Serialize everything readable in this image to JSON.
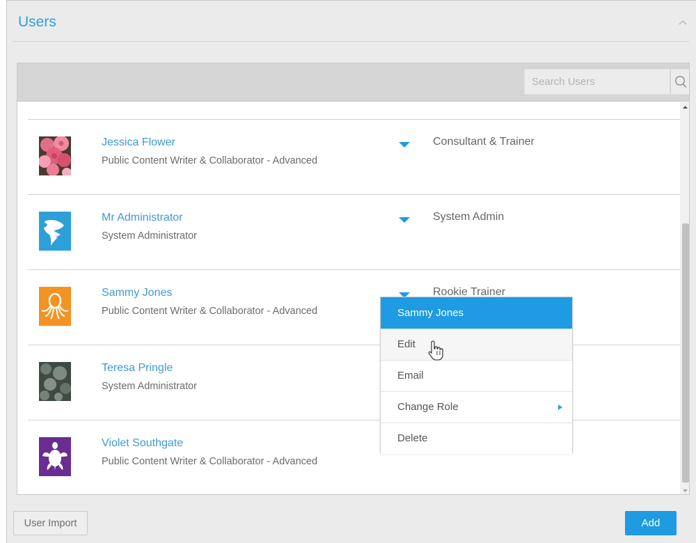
{
  "panel": {
    "title": "Users"
  },
  "search": {
    "placeholder": "Search Users",
    "value": ""
  },
  "users": [
    {
      "name": "Jessica Flower",
      "role": "Public Content Writer & Collaborator - Advanced",
      "title": "Consultant & Trainer",
      "avatar_icon": "flower-photo"
    },
    {
      "name": "Mr Administrator",
      "role": "System Administrator",
      "title": "System Admin",
      "avatar_icon": "shark-icon"
    },
    {
      "name": "Sammy Jones",
      "role": "Public Content Writer & Collaborator - Advanced",
      "title": "Rookie Trainer",
      "avatar_icon": "octopus-icon"
    },
    {
      "name": "Teresa Pringle",
      "role": "System Administrator",
      "title": "",
      "avatar_icon": "bokeh-photo"
    },
    {
      "name": "Violet Southgate",
      "role": "Public Content Writer & Collaborator - Advanced",
      "title": "",
      "avatar_icon": "turtle-icon"
    }
  ],
  "context_menu": {
    "header": "Sammy Jones",
    "items": [
      {
        "label": "Edit"
      },
      {
        "label": "Email"
      },
      {
        "label": "Change Role"
      },
      {
        "label": "Delete"
      }
    ]
  },
  "footer": {
    "import_label": "User Import",
    "add_label": "Add"
  },
  "colors": {
    "accent": "#1e9be3",
    "link": "#3d9ad5",
    "avatar_blue": "#2d9fd9",
    "avatar_orange": "#f39323",
    "avatar_purple": "#6a2d91"
  }
}
